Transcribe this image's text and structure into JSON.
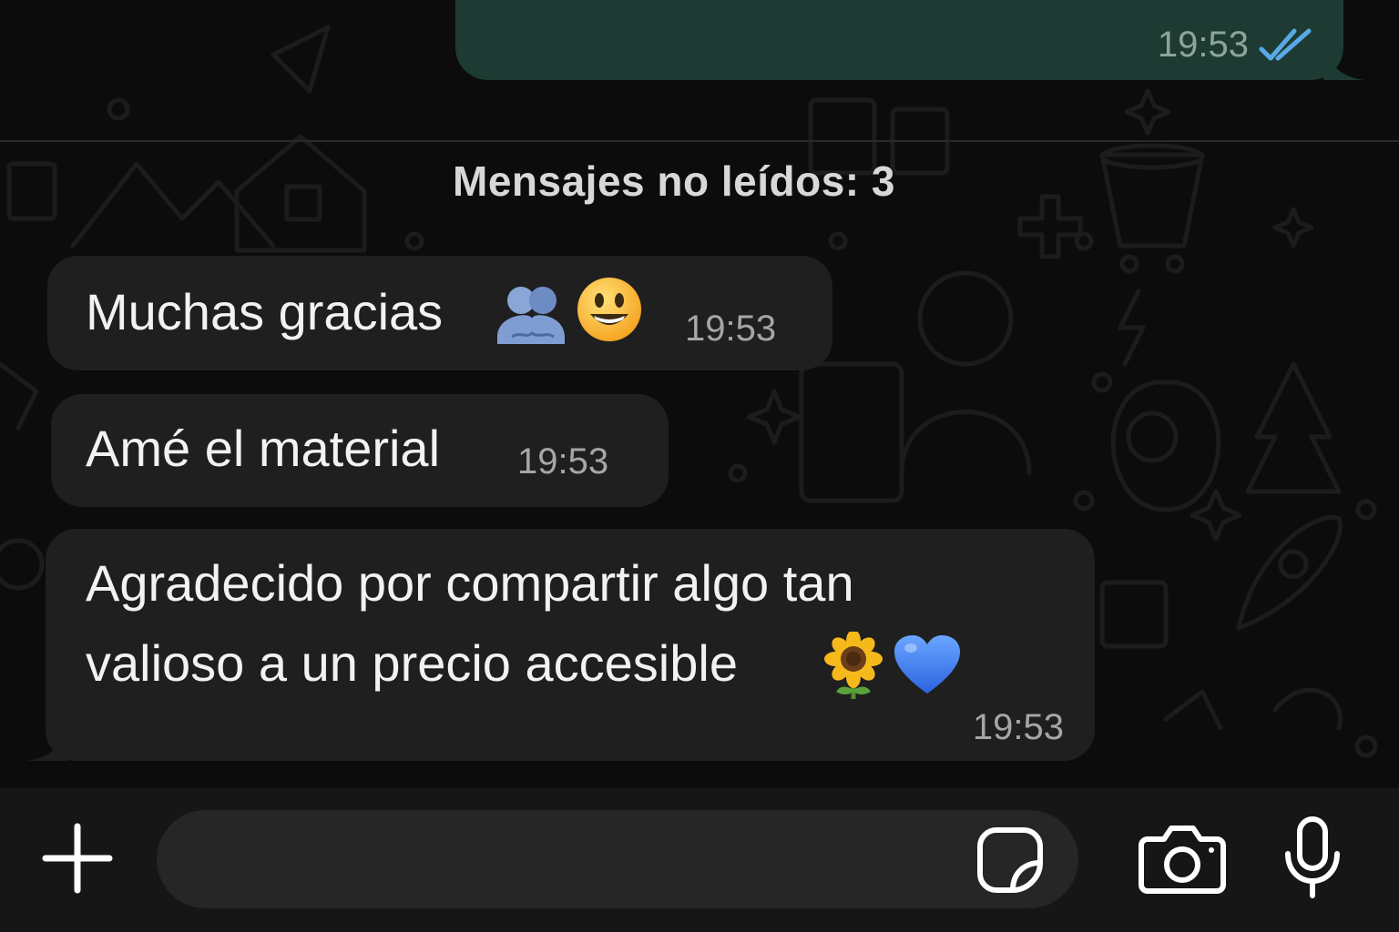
{
  "chat": {
    "outgoing_message": {
      "time": "19:53",
      "status": "read"
    },
    "unread_divider": "Mensajes no leídos: 3",
    "incoming_messages": [
      {
        "text": "Muchas gracias",
        "emojis": [
          "people-hugging-emoji",
          "smiling-face-emoji"
        ],
        "time": "19:53"
      },
      {
        "text": "Amé el material",
        "time": "19:53"
      },
      {
        "text_line_1": "Agradecido por compartir algo tan",
        "text_line_2": "valioso a un precio accesible",
        "emojis": [
          "sunflower-emoji",
          "blue-heart-emoji"
        ],
        "time": "19:53"
      }
    ]
  },
  "input_bar": {
    "message_value": "",
    "icons": [
      "plus-icon",
      "sticker-icon",
      "camera-icon",
      "microphone-icon"
    ]
  },
  "colors": {
    "background": "#0c0c0c",
    "incoming_bubble": "#1f1f1f",
    "outgoing_bubble": "#1e3b33",
    "read_ticks": "#5aa9e6",
    "input_bar": "#161616"
  }
}
